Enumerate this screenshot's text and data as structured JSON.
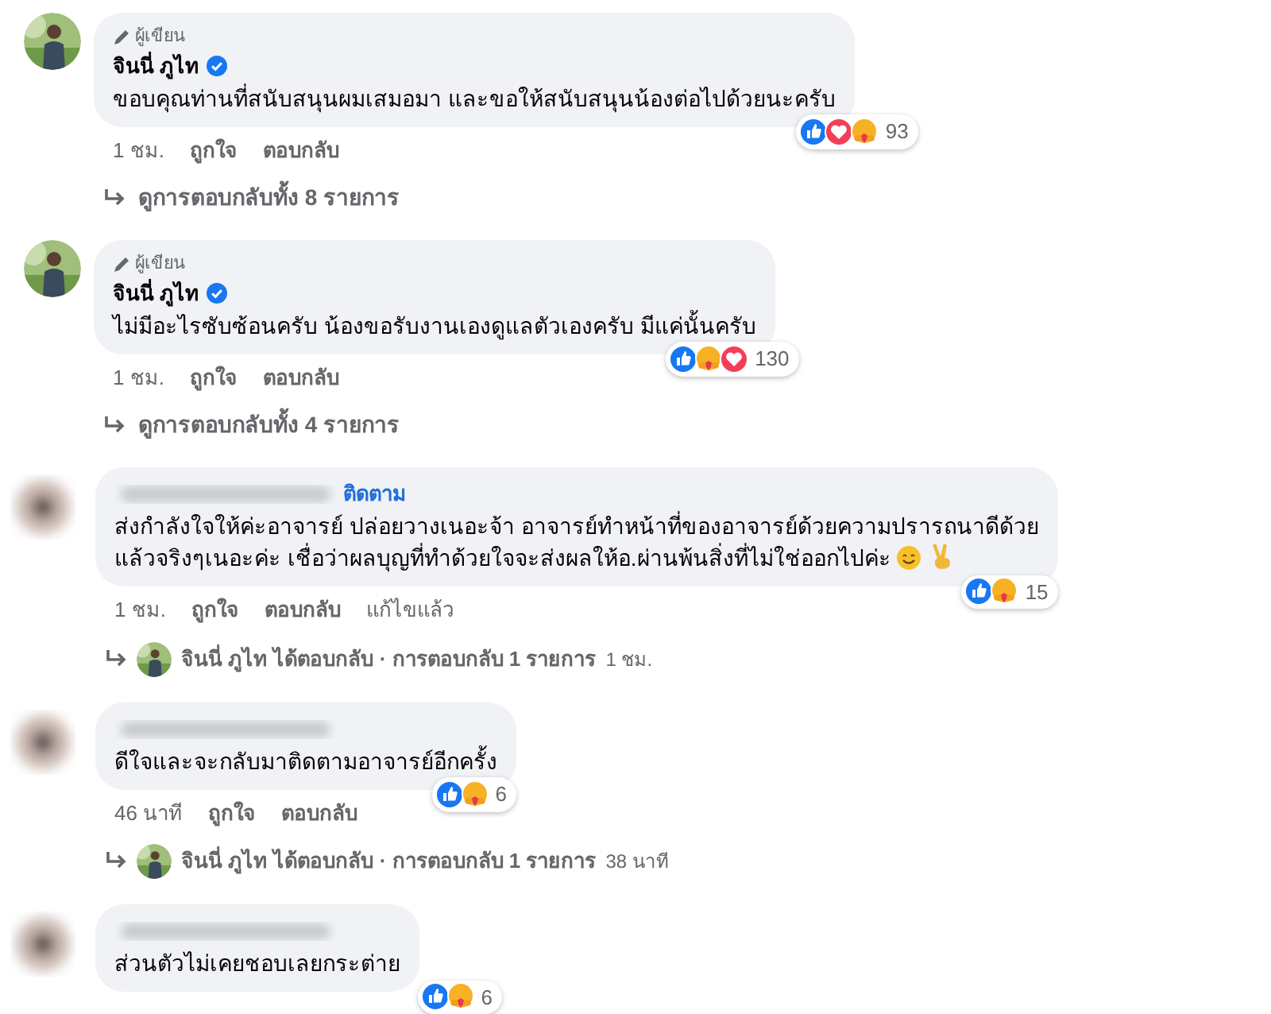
{
  "comments": [
    {
      "avatar": {
        "kind": "picture",
        "blurred": false
      },
      "badge": "ผู้เขียน",
      "author": "จินนี่ ภูไท",
      "verified": true,
      "lines": [
        "ขอบคุณท่านที่สนับสนุนผมเสมอมา และขอให้สนับสนุนน้องต่อไปด้วยนะครับ"
      ],
      "reactions": [
        {
          "kind": "like"
        },
        {
          "kind": "love"
        },
        {
          "kind": "care"
        }
      ],
      "count": "93",
      "meta": [
        "1 ชม.",
        "ถูกใจ",
        "ตอบกลับ"
      ],
      "replies": {
        "kind": "view",
        "text": "ดูการตอบกลับทั้ง 8 รายการ"
      }
    },
    {
      "avatar": {
        "kind": "picture",
        "blurred": false
      },
      "badge": "ผู้เขียน",
      "author": "จินนี่ ภูไท",
      "verified": true,
      "lines": [
        "ไม่มีอะไรซับซ้อนครับ น้องขอรับงานเองดูแลตัวเองครับ มีแค่นั้นครับ"
      ],
      "reactions": [
        {
          "kind": "like"
        },
        {
          "kind": "care"
        },
        {
          "kind": "love"
        }
      ],
      "count": "130",
      "meta": [
        "1 ชม.",
        "ถูกใจ",
        "ตอบกลับ"
      ],
      "replies": {
        "kind": "view",
        "text": "ดูการตอบกลับทั้ง 4 รายการ"
      }
    },
    {
      "avatar": {
        "kind": "picture",
        "blurred": true
      },
      "follow": "ติดตาม",
      "lines": [
        "ส่งกำลังใจให้ค่ะอาจารย์ ปล่อยวางเนอะจ้า อาจารย์ทำหน้าที่ของอาจารย์ด้วยความปรารถนาดีด้วย",
        "แล้วจริงๆเนอะค่ะ เชื่อว่าผลบุญที่ทำด้วยใจจะส่งผลให้อ.ผ่านพ้นสิ่งที่ไม่ใช่ออกไปค่ะ"
      ],
      "emoji": [
        {
          "kind": "smile"
        },
        {
          "kind": "victory"
        }
      ],
      "reactions": [
        {
          "kind": "like"
        },
        {
          "kind": "care"
        }
      ],
      "count": "15",
      "meta": [
        "1 ชม.",
        "ถูกใจ",
        "ตอบกลับ",
        "แก้ไขแล้ว"
      ],
      "replies": {
        "kind": "summary",
        "text": "จินนี่ ภูไท ได้ตอบกลับ · การตอบกลับ 1 รายการ",
        "time": "1 ชม."
      }
    },
    {
      "avatar": {
        "kind": "picture",
        "blurred": true
      },
      "lines": [
        "ดีใจและจะกลับมาติดตามอาจารย์อีกครั้ง"
      ],
      "reactions": [
        {
          "kind": "like"
        },
        {
          "kind": "care"
        }
      ],
      "count": "6",
      "meta": [
        "46 นาที",
        "ถูกใจ",
        "ตอบกลับ"
      ],
      "replies": {
        "kind": "summary",
        "text": "จินนี่ ภูไท ได้ตอบกลับ · การตอบกลับ 1 รายการ",
        "time": "38 นาที"
      }
    },
    {
      "avatar": {
        "kind": "picture",
        "blurred": true
      },
      "lines": [
        "ส่วนตัวไม่เคยชอบเลยกระต่าย"
      ],
      "reactions": [
        {
          "kind": "like"
        },
        {
          "kind": "care"
        }
      ],
      "count": "6"
    }
  ]
}
